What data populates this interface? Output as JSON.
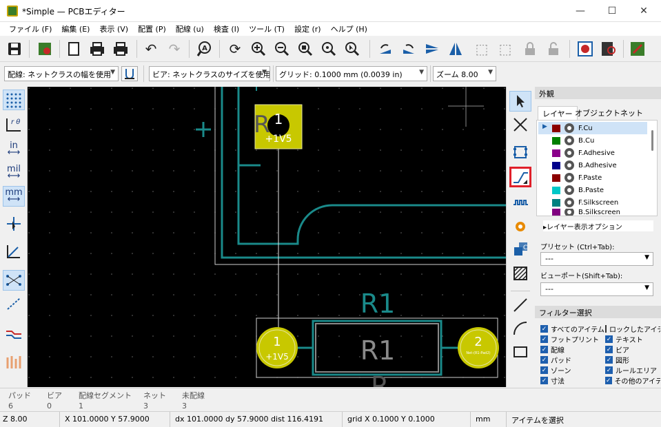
{
  "window": {
    "title": "*Simple — PCBエディター",
    "controls": {
      "minimize": "—",
      "maximize": "☐",
      "close": "✕"
    }
  },
  "menu": [
    "ファイル (F)",
    "編集 (E)",
    "表示 (V)",
    "配置 (P)",
    "配線 (u)",
    "検査 (I)",
    "ツール (T)",
    "設定 (r)",
    "ヘルプ (H)"
  ],
  "selectors": {
    "track_width": "配線: ネットクラスの幅を使用",
    "via_size": "ビア: ネットクラスのサイズを使用",
    "grid": "グリッド: 0.1000 mm (0.0039 in)",
    "zoom": "ズーム 8.00"
  },
  "left_toolbar": {
    "polar_label": "r θ",
    "inch_label": "in",
    "mil_label": "mil",
    "mm_label": "mm"
  },
  "canvas": {
    "background": "#000000",
    "pad_color": "#c8c800",
    "trace_color": "#1a8a8a",
    "ref_label_top": "R1",
    "ref_label_body": "R1",
    "pad1_number": "1",
    "pad1_net": "+1V5",
    "pad2_number": "2",
    "pad2_net": "Net-(R1-Pad2)",
    "smd_pad_number": "1",
    "smd_pad_net": "+1V5",
    "smd_ref_fragment": "R",
    "partial_text_bottom": "R",
    "ratsnest_note": ""
  },
  "appearance_panel": {
    "header": "外観",
    "tabs": [
      "レイヤー",
      "オブジェクト",
      "ネット"
    ],
    "layers": [
      {
        "name": "F.Cu",
        "color": "#8b0000"
      },
      {
        "name": "B.Cu",
        "color": "#008000"
      },
      {
        "name": "F.Adhesive",
        "color": "#8b008b"
      },
      {
        "name": "B.Adhesive",
        "color": "#00008b"
      },
      {
        "name": "F.Paste",
        "color": "#8b0000"
      },
      {
        "name": "B.Paste",
        "color": "#00c8c8"
      },
      {
        "name": "F.Silkscreen",
        "color": "#008080"
      },
      {
        "name": "B.Silkscreen",
        "color": "#800080"
      }
    ],
    "layer_display_options": "▸レイヤー表示オプション",
    "preset_label": "プリセット (Ctrl+Tab):",
    "preset_value": "---",
    "viewport_label": "ビューポート(Shift+Tab):",
    "viewport_value": "---"
  },
  "filter_panel": {
    "header": "フィルター選択",
    "items": [
      {
        "label": "すべてのアイテム",
        "checked": true
      },
      {
        "label": "ロックしたアイテム",
        "checked": false
      },
      {
        "label": "フットプリント",
        "checked": true
      },
      {
        "label": "テキスト",
        "checked": true
      },
      {
        "label": "配線",
        "checked": true
      },
      {
        "label": "ビア",
        "checked": true
      },
      {
        "label": "パッド",
        "checked": true
      },
      {
        "label": "図形",
        "checked": true
      },
      {
        "label": "ゾーン",
        "checked": true
      },
      {
        "label": "ルールエリア",
        "checked": true
      },
      {
        "label": "寸法",
        "checked": true
      },
      {
        "label": "その他のアイテム",
        "checked": true
      }
    ]
  },
  "info_panel": [
    {
      "label": "パッド",
      "value": "6"
    },
    {
      "label": "ビア",
      "value": "0"
    },
    {
      "label": "配線セグメント",
      "value": "1"
    },
    {
      "label": "ネット",
      "value": "3"
    },
    {
      "label": "未配線",
      "value": "3"
    }
  ],
  "status": {
    "zoom": "Z 8.00",
    "coords": "X 101.0000  Y 57.9000",
    "delta": "dx 101.0000  dy 57.9000  dist 116.4191",
    "grid": "grid X 0.1000  Y 0.1000",
    "units": "mm",
    "message": "アイテムを選択"
  }
}
